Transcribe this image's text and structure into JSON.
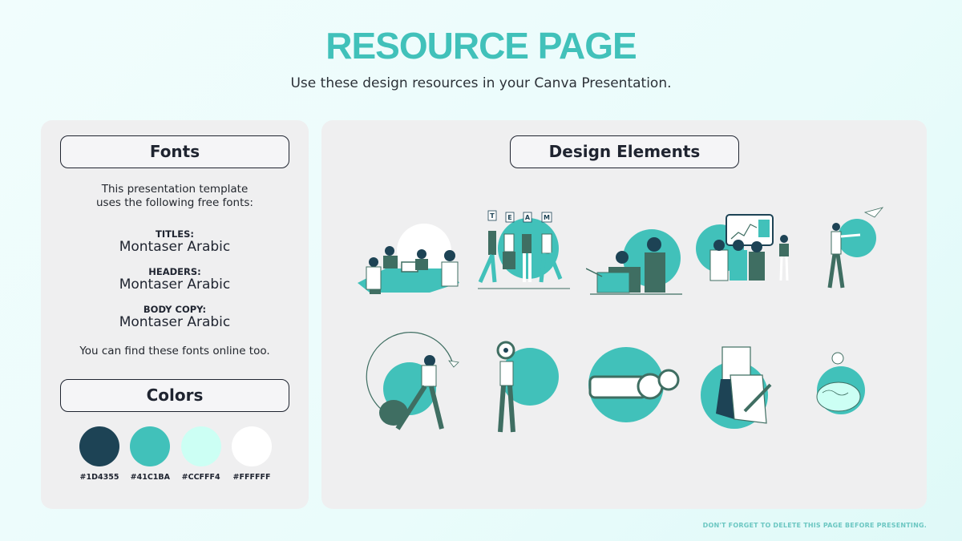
{
  "header": {
    "title": "RESOURCE PAGE",
    "subtitle": "Use these design resources in your Canva Presentation."
  },
  "fonts_panel": {
    "heading": "Fonts",
    "intro_line1": "This presentation template",
    "intro_line2": "uses the following free fonts:",
    "fonts": [
      {
        "label": "TITLES:",
        "name": "Montaser Arabic"
      },
      {
        "label": "HEADERS:",
        "name": "Montaser Arabic"
      },
      {
        "label": "BODY COPY:",
        "name": "Montaser Arabic"
      }
    ],
    "outro": "You can find these fonts online too."
  },
  "colors_panel": {
    "heading": "Colors",
    "swatches": [
      {
        "hex": "#1D4355",
        "color": "#1D4355"
      },
      {
        "hex": "#41C1BA",
        "color": "#41C1BA"
      },
      {
        "hex": "#CCFFF4",
        "color": "#CCFFF4"
      },
      {
        "hex": "#FFFFFF",
        "color": "#FFFFFF"
      }
    ]
  },
  "design_panel": {
    "heading": "Design Elements",
    "elements": [
      {
        "name": "team-meeting-illustration"
      },
      {
        "name": "team-letters-illustration",
        "letters": [
          "T",
          "E",
          "A",
          "M"
        ]
      },
      {
        "name": "laptop-coworkers-illustration"
      },
      {
        "name": "presentation-board-illustration"
      },
      {
        "name": "paper-plane-illustration"
      },
      {
        "name": "arrow-circle-woman-illustration"
      },
      {
        "name": "magnifier-woman-illustration"
      },
      {
        "name": "binoculars-illustration"
      },
      {
        "name": "notepad-pen-illustration"
      },
      {
        "name": "brain-lightbulb-illustration"
      }
    ]
  },
  "palette": {
    "teal": "#41C1BA",
    "dark": "#3f6e62",
    "navy": "#1D4355",
    "white": "#FFFFFF"
  },
  "footer": {
    "note": "DON'T FORGET TO DELETE THIS PAGE BEFORE PRESENTING."
  }
}
